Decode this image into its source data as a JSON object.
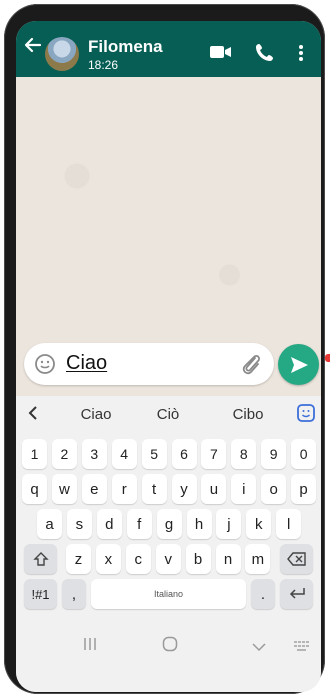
{
  "header": {
    "contact_name": "Filomena",
    "last_seen": "18:26",
    "back_icon": "arrow-left-icon",
    "video_icon": "video-camera-icon",
    "call_icon": "phone-icon",
    "menu_icon": "more-vertical-icon"
  },
  "composer": {
    "text": "Ciao",
    "emoji_icon": "smiley-icon",
    "attach_icon": "paperclip-icon",
    "send_icon": "send-icon"
  },
  "keyboard": {
    "suggestions": [
      "Ciao",
      "Ciò",
      "Cibo"
    ],
    "number_row": [
      "1",
      "2",
      "3",
      "4",
      "5",
      "6",
      "7",
      "8",
      "9",
      "0"
    ],
    "row1": [
      "q",
      "w",
      "e",
      "r",
      "t",
      "y",
      "u",
      "i",
      "o",
      "p"
    ],
    "row2": [
      "a",
      "s",
      "d",
      "f",
      "g",
      "h",
      "j",
      "k",
      "l"
    ],
    "row3": [
      "z",
      "x",
      "c",
      "v",
      "b",
      "n",
      "m"
    ],
    "symbols_key": "!#1",
    "comma_key": ",",
    "space_label": "Italiano",
    "period_key": "."
  },
  "colors": {
    "header": "#075e54",
    "send": "#25a884",
    "chat_bg": "#ece5dd"
  }
}
